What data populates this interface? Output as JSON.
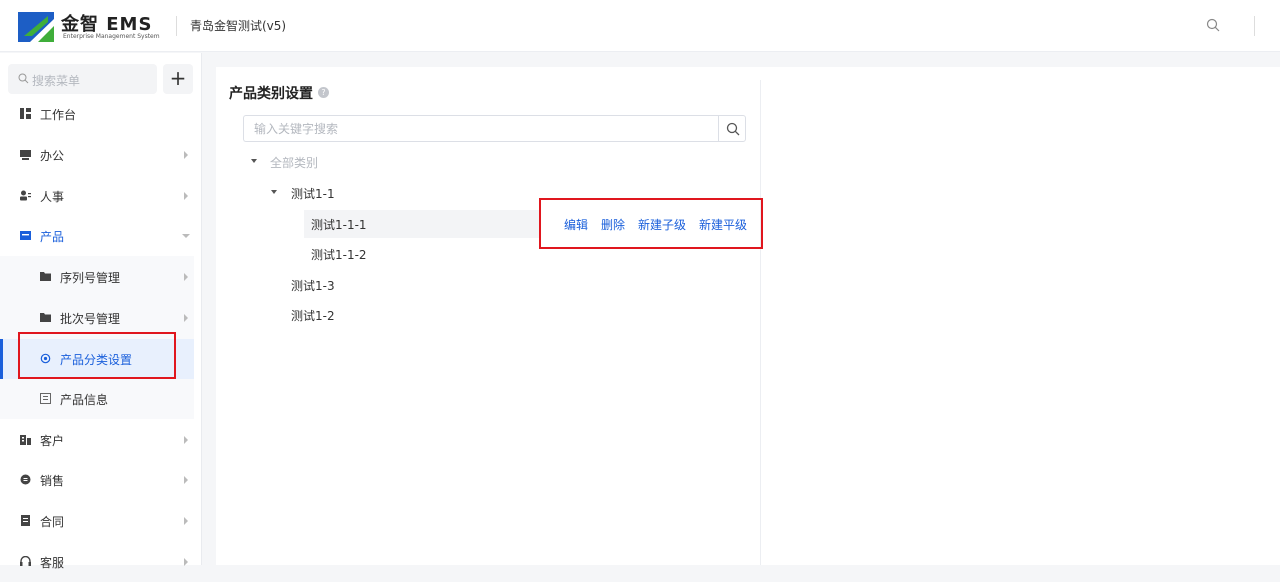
{
  "header": {
    "logo_title": "金智 EMS",
    "logo_subtitle": "Enterprise Management System",
    "company_name": "青岛金智测试(v5)",
    "colors": {
      "brand_green": "#3fae3a",
      "brand_blue": "#1d5ec5"
    }
  },
  "sidebar": {
    "search_placeholder": "搜索菜单",
    "add_label": "+",
    "items": [
      {
        "label": "工作台",
        "icon": "dashboard-icon"
      },
      {
        "label": "办公",
        "icon": "office-icon"
      },
      {
        "label": "人事",
        "icon": "people-icon"
      },
      {
        "label": "产品",
        "icon": "product-icon"
      },
      {
        "label": "序列号管理",
        "icon": "folder-icon"
      },
      {
        "label": "批次号管理",
        "icon": "folder-icon"
      },
      {
        "label": "产品分类设置",
        "icon": "settings-gear-icon"
      },
      {
        "label": "产品信息",
        "icon": "info-doc-icon"
      },
      {
        "label": "客户",
        "icon": "building-icon"
      },
      {
        "label": "销售",
        "icon": "sales-icon"
      },
      {
        "label": "合同",
        "icon": "contract-icon"
      },
      {
        "label": "客服",
        "icon": "headset-icon"
      }
    ]
  },
  "main": {
    "page_title": "产品类别设置",
    "help_glyph": "?",
    "search_placeholder": "输入关键字搜索",
    "tree": {
      "root": "全部类别",
      "n1": "测试1-1",
      "n11": "测试1-1-1",
      "n12": "测试1-1-2",
      "n13": "测试1-3",
      "n2": "测试1-2"
    },
    "actions": {
      "edit": "编辑",
      "delete": "删除",
      "add_child": "新建子级",
      "add_sibling": "新建平级"
    }
  },
  "colors": {
    "accent": "#1a5fdb",
    "highlight_red": "#e0161e"
  }
}
